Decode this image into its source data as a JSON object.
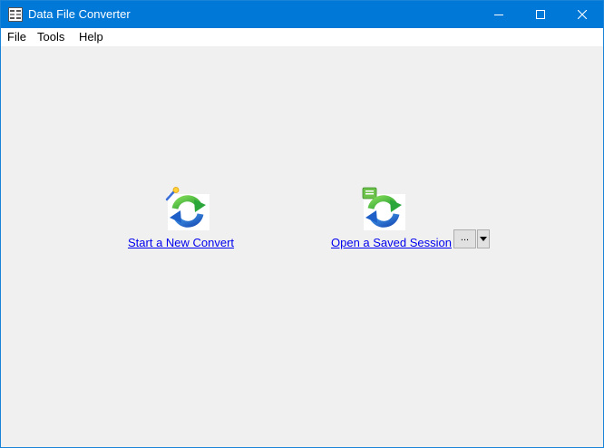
{
  "window": {
    "title": "Data File Converter",
    "accent_color": "#0078d7",
    "app_icon": "data-file-app-icon",
    "controls": [
      "minimize-icon",
      "maximize-icon",
      "close-icon"
    ]
  },
  "menu": {
    "items": [
      {
        "label": "File"
      },
      {
        "label": "Tools"
      },
      {
        "label": "Help"
      }
    ]
  },
  "main": {
    "new_convert": {
      "label": "Start a New Convert",
      "icon": "new-convert-icon"
    },
    "saved_session": {
      "label": "Open a Saved Session",
      "icon": "saved-session-icon",
      "browse_label": "...",
      "dropdown_icon": "dropdown-arrow-icon"
    },
    "link_color": "#0000ee"
  }
}
